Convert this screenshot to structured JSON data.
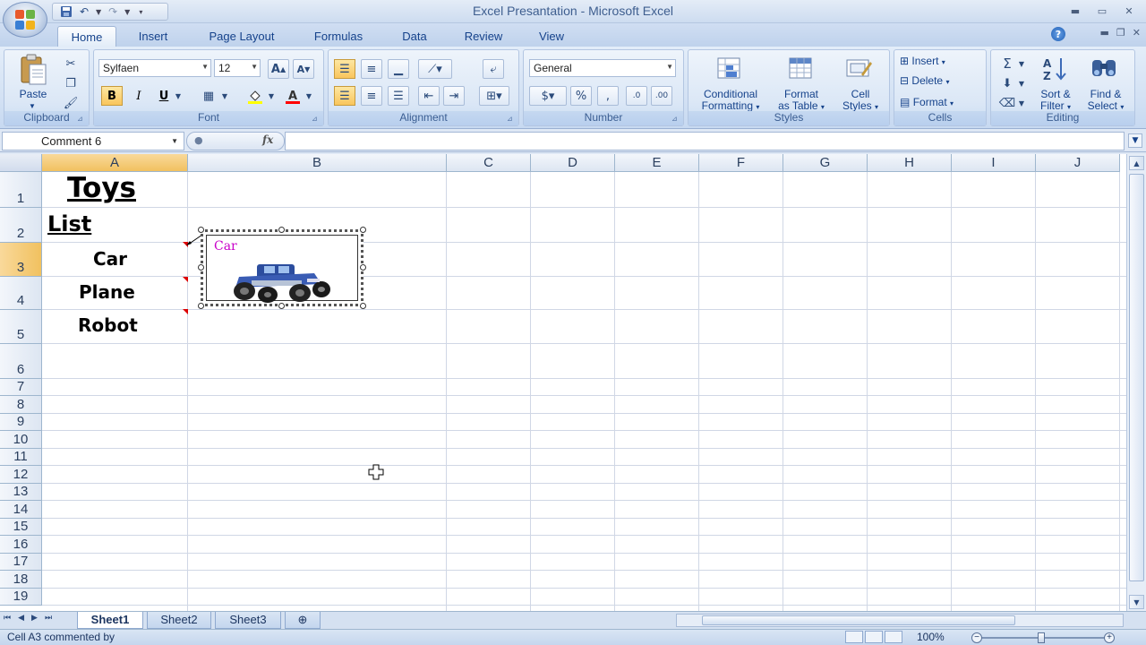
{
  "window": {
    "title": "Excel Presantation - Microsoft Excel"
  },
  "tabs": [
    "Home",
    "Insert",
    "Page Layout",
    "Formulas",
    "Data",
    "Review",
    "View"
  ],
  "ribbon": {
    "clipboard": {
      "label": "Clipboard",
      "paste": "Paste"
    },
    "font": {
      "label": "Font",
      "name": "Sylfaen",
      "size": "12"
    },
    "alignment": {
      "label": "Alignment"
    },
    "number": {
      "label": "Number",
      "format": "General"
    },
    "styles": {
      "label": "Styles",
      "conditional_1": "Conditional",
      "conditional_2": "Formatting",
      "format_table_1": "Format",
      "format_table_2": "as Table",
      "cell_styles_1": "Cell",
      "cell_styles_2": "Styles"
    },
    "cells": {
      "label": "Cells",
      "insert": "Insert",
      "delete": "Delete",
      "format": "Format"
    },
    "editing": {
      "label": "Editing",
      "sort_1": "Sort &",
      "sort_2": "Filter",
      "find_1": "Find &",
      "find_2": "Select"
    }
  },
  "formula_bar": {
    "name_box": "Comment 6",
    "formula": ""
  },
  "columns": [
    "A",
    "B",
    "C",
    "D",
    "E",
    "F",
    "G",
    "H",
    "I",
    "J"
  ],
  "rows": [
    "1",
    "2",
    "3",
    "4",
    "5",
    "6",
    "7",
    "8",
    "9",
    "10",
    "11",
    "12",
    "13",
    "14",
    "15",
    "16",
    "17",
    "18",
    "19"
  ],
  "cells": {
    "A1": "Toys",
    "A2": "List",
    "A3": "Car",
    "A4": "Plane",
    "A5": "Robot"
  },
  "comment": {
    "text": "Car",
    "image": "monster-truck-toy"
  },
  "sheets": [
    "Sheet1",
    "Sheet2",
    "Sheet3"
  ],
  "status": {
    "message": "Cell A3 commented by",
    "zoom": "100%"
  },
  "colors": {
    "comment_text": "#c800c8",
    "comment_marker": "#dd0000"
  }
}
